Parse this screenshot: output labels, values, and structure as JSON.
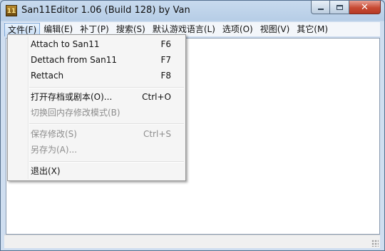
{
  "window": {
    "title": "San11Editor 1.06 (Build 128) by Van",
    "icon_label": "11",
    "close_glyph": "✕"
  },
  "menubar": {
    "items": [
      "文件(F)",
      "编辑(E)",
      "补丁(P)",
      "搜索(S)",
      "默认游戏语言(L)",
      "选项(O)",
      "视图(V)",
      "其它(M)"
    ]
  },
  "file_menu": {
    "items": [
      {
        "label": "Attach to San11",
        "shortcut": "F6",
        "enabled": true
      },
      {
        "label": "Dettach from San11",
        "shortcut": "F7",
        "enabled": true
      },
      {
        "label": "Rettach",
        "shortcut": "F8",
        "enabled": true
      },
      {
        "label": "打开存档或剧本(O)...",
        "shortcut": "Ctrl+O",
        "enabled": true
      },
      {
        "label": "切换回内存修改模式(B)",
        "shortcut": "",
        "enabled": false
      },
      {
        "label": "保存修改(S)",
        "shortcut": "Ctrl+S",
        "enabled": false
      },
      {
        "label": "另存为(A)...",
        "shortcut": "",
        "enabled": false
      },
      {
        "label": "退出(X)",
        "shortcut": "",
        "enabled": true
      }
    ]
  }
}
